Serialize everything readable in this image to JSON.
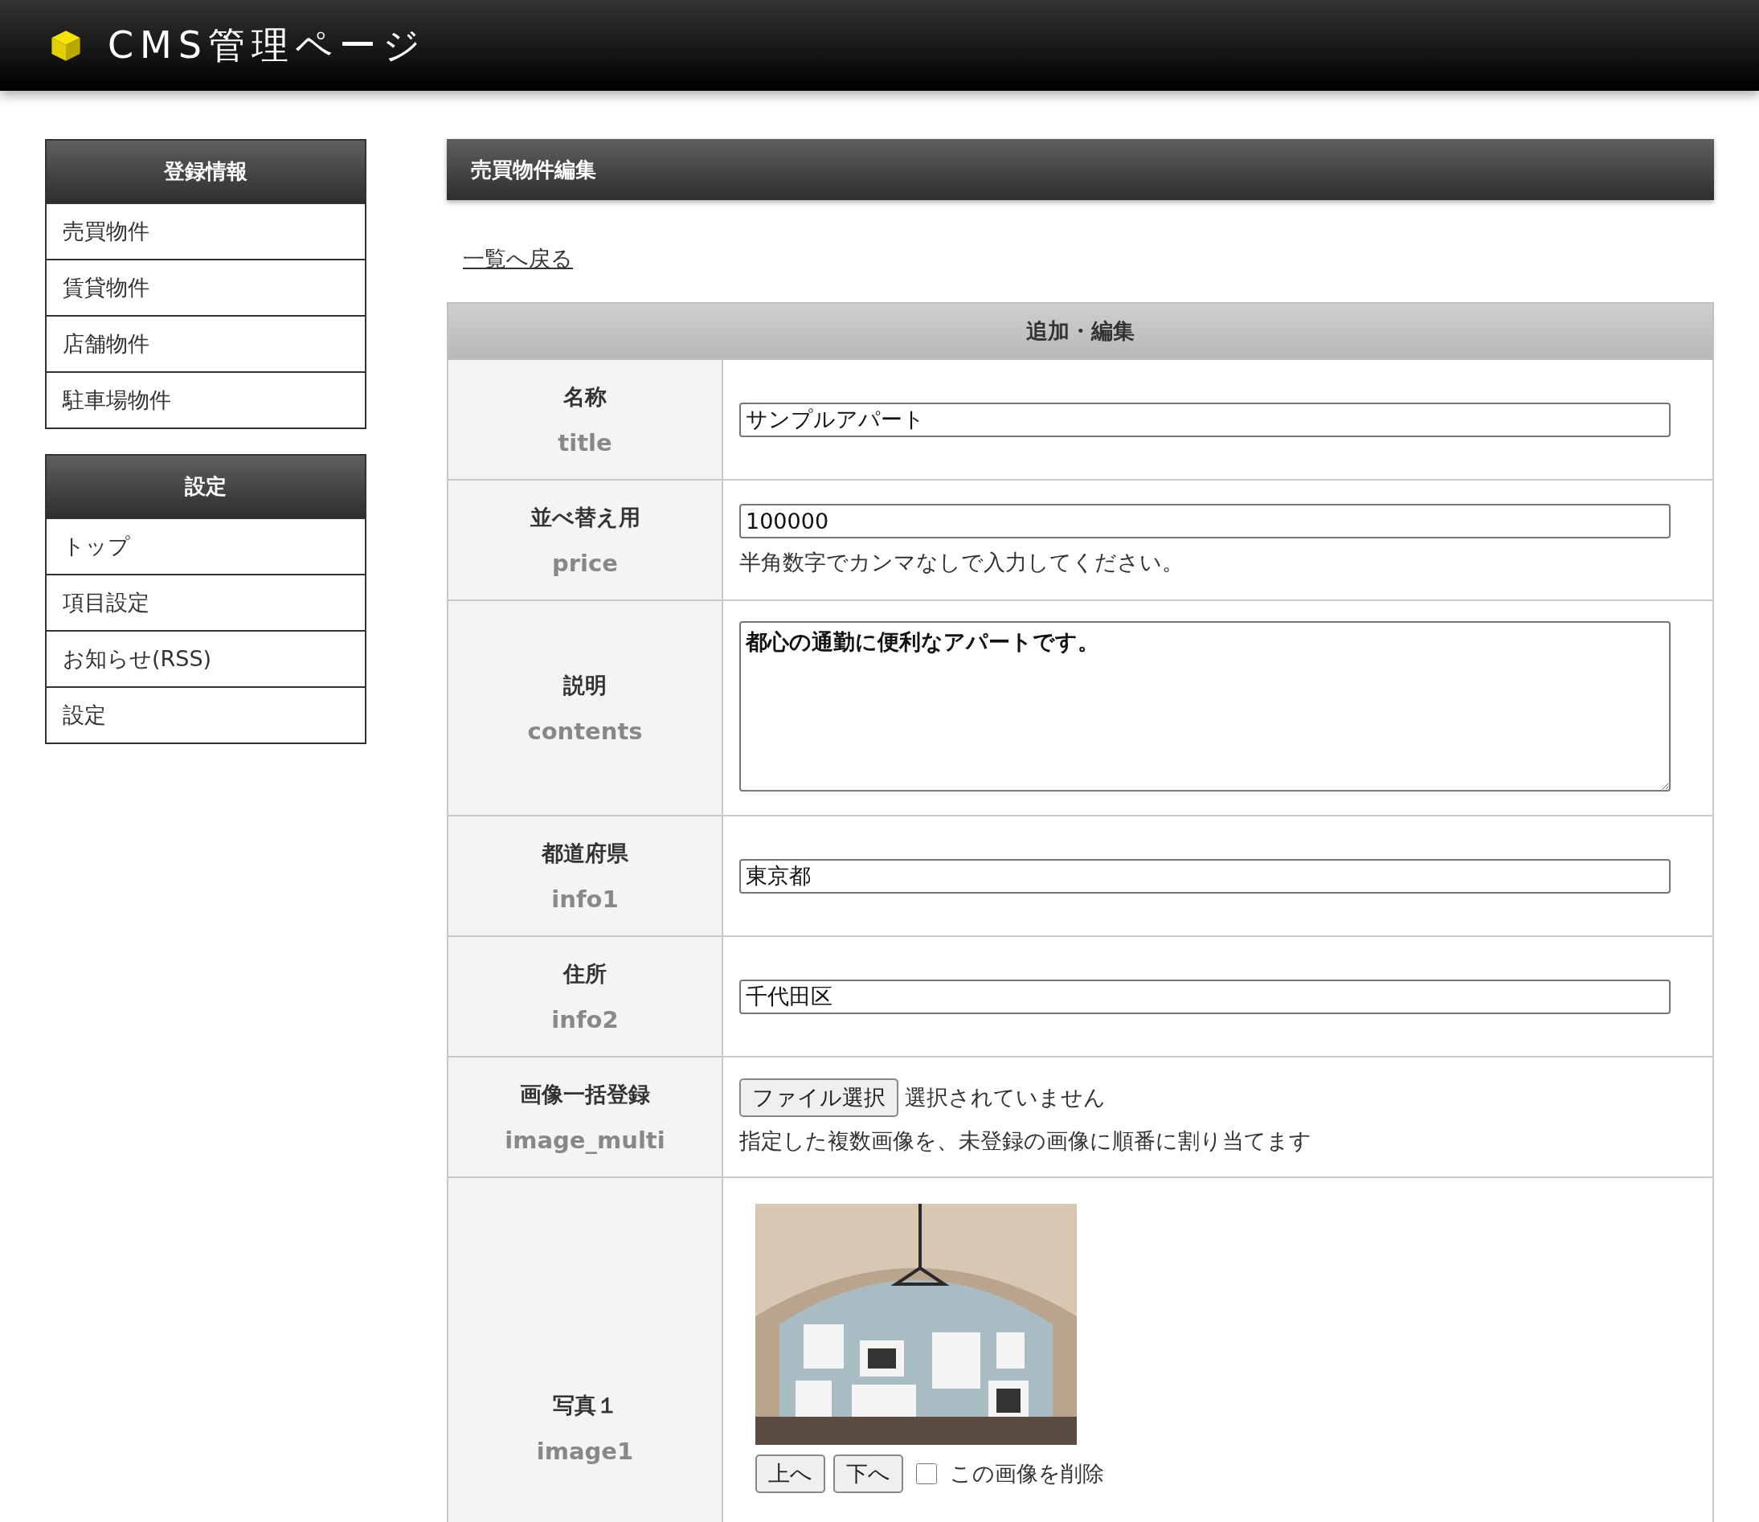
{
  "header": {
    "title": "CMS管理ページ"
  },
  "sidebar": [
    {
      "title": "登録情報",
      "items": [
        "売買物件",
        "賃貸物件",
        "店舗物件",
        "駐車場物件"
      ]
    },
    {
      "title": "設定",
      "items": [
        "トップ",
        "項目設定",
        "お知らせ(RSS)",
        "設定"
      ]
    }
  ],
  "main": {
    "title": "売買物件編集",
    "back_link": "一覧へ戻る",
    "table_title": "追加・編集",
    "rows": [
      {
        "kind": "text",
        "label": "名称",
        "key": "title",
        "value": "サンプルアパート"
      },
      {
        "kind": "text",
        "label": "並べ替え用",
        "key": "price",
        "value": "100000",
        "hint": "半角数字でカンマなしで入力してください。"
      },
      {
        "kind": "textarea",
        "label": "説明",
        "key": "contents",
        "value": "都心の通勤に便利なアパートです。"
      },
      {
        "kind": "text",
        "label": "都道府県",
        "key": "info1",
        "value": "東京都"
      },
      {
        "kind": "text",
        "label": "住所",
        "key": "info2",
        "value": "千代田区"
      },
      {
        "kind": "file",
        "label": "画像一括登録",
        "key": "image_multi",
        "button": "ファイル選択",
        "status": "選択されていません",
        "hint": "指定した複数画像を、未登録の画像に順番に割り当てます"
      },
      {
        "label": "写真１",
        "key": "image1",
        "up": "上へ",
        "down": "下へ",
        "delete": {
          "label": "この画像を削除",
          "checked": false
        }
      }
    ]
  }
}
